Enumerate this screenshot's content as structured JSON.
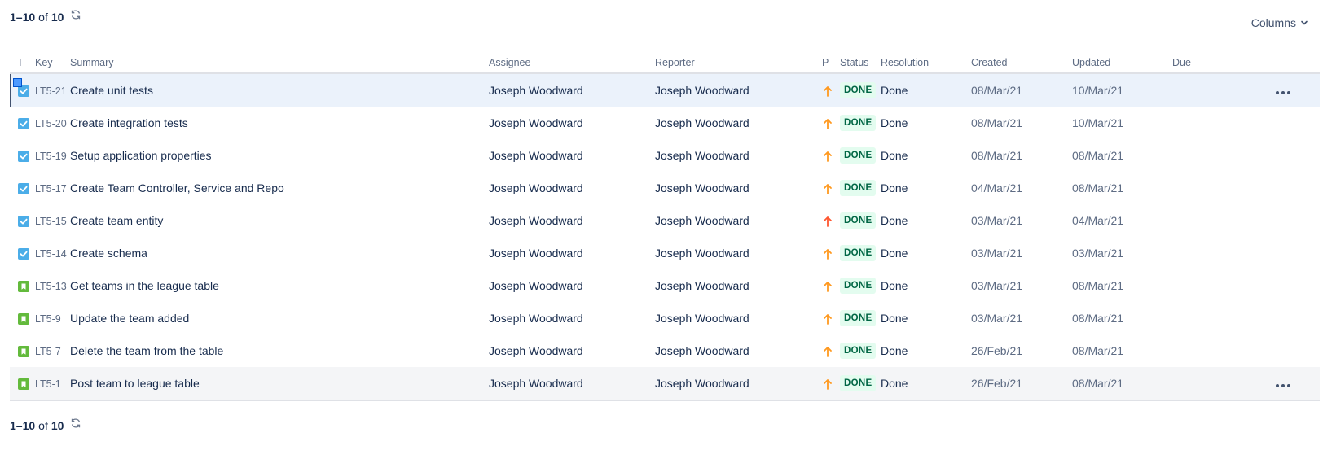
{
  "pager": {
    "range": "1–10",
    "of": "of",
    "total": "10"
  },
  "columns_button": "Columns",
  "headers": {
    "type": "T",
    "key": "Key",
    "summary": "Summary",
    "assignee": "Assignee",
    "reporter": "Reporter",
    "priority": "P",
    "status": "Status",
    "resolution": "Resolution",
    "created": "Created",
    "updated": "Updated",
    "due": "Due"
  },
  "colors": {
    "task": "#4bade8",
    "story": "#63ba3c",
    "priority_high": "#ff991f",
    "priority_highest": "#ff5630",
    "status_done_bg": "#e3fcef",
    "status_done_fg": "#006644"
  },
  "rows": [
    {
      "type": "task",
      "type_icon": "checkbox-icon",
      "key": "LT5-21",
      "summary": "Create unit tests",
      "assignee": "Joseph Woodward",
      "reporter": "Joseph Woodward",
      "priority": "high",
      "priority_icon": "arrow-up-icon",
      "status": "DONE",
      "resolution": "Done",
      "created": "08/Mar/21",
      "updated": "10/Mar/21",
      "due": ""
    },
    {
      "type": "task",
      "type_icon": "checkbox-icon",
      "key": "LT5-20",
      "summary": "Create integration tests",
      "assignee": "Joseph Woodward",
      "reporter": "Joseph Woodward",
      "priority": "high",
      "priority_icon": "arrow-up-icon",
      "status": "DONE",
      "resolution": "Done",
      "created": "08/Mar/21",
      "updated": "10/Mar/21",
      "due": ""
    },
    {
      "type": "task",
      "type_icon": "checkbox-icon",
      "key": "LT5-19",
      "summary": "Setup application properties",
      "assignee": "Joseph Woodward",
      "reporter": "Joseph Woodward",
      "priority": "high",
      "priority_icon": "arrow-up-icon",
      "status": "DONE",
      "resolution": "Done",
      "created": "08/Mar/21",
      "updated": "08/Mar/21",
      "due": ""
    },
    {
      "type": "task",
      "type_icon": "checkbox-icon",
      "key": "LT5-17",
      "summary": "Create Team Controller, Service and Repo",
      "assignee": "Joseph Woodward",
      "reporter": "Joseph Woodward",
      "priority": "high",
      "priority_icon": "arrow-up-icon",
      "status": "DONE",
      "resolution": "Done",
      "created": "04/Mar/21",
      "updated": "08/Mar/21",
      "due": ""
    },
    {
      "type": "task",
      "type_icon": "checkbox-icon",
      "key": "LT5-15",
      "summary": "Create team entity",
      "assignee": "Joseph Woodward",
      "reporter": "Joseph Woodward",
      "priority": "highest",
      "priority_icon": "arrow-up-icon",
      "status": "DONE",
      "resolution": "Done",
      "created": "03/Mar/21",
      "updated": "04/Mar/21",
      "due": ""
    },
    {
      "type": "task",
      "type_icon": "checkbox-icon",
      "key": "LT5-14",
      "summary": "Create schema",
      "assignee": "Joseph Woodward",
      "reporter": "Joseph Woodward",
      "priority": "high",
      "priority_icon": "arrow-up-icon",
      "status": "DONE",
      "resolution": "Done",
      "created": "03/Mar/21",
      "updated": "03/Mar/21",
      "due": ""
    },
    {
      "type": "story",
      "type_icon": "bookmark-icon",
      "key": "LT5-13",
      "summary": "Get teams in the league table",
      "assignee": "Joseph Woodward",
      "reporter": "Joseph Woodward",
      "priority": "high",
      "priority_icon": "arrow-up-icon",
      "status": "DONE",
      "resolution": "Done",
      "created": "03/Mar/21",
      "updated": "08/Mar/21",
      "due": ""
    },
    {
      "type": "story",
      "type_icon": "bookmark-icon",
      "key": "LT5-9",
      "summary": "Update the team added",
      "assignee": "Joseph Woodward",
      "reporter": "Joseph Woodward",
      "priority": "high",
      "priority_icon": "arrow-up-icon",
      "status": "DONE",
      "resolution": "Done",
      "created": "03/Mar/21",
      "updated": "08/Mar/21",
      "due": ""
    },
    {
      "type": "story",
      "type_icon": "bookmark-icon",
      "key": "LT5-7",
      "summary": "Delete the team from the table",
      "assignee": "Joseph Woodward",
      "reporter": "Joseph Woodward",
      "priority": "high",
      "priority_icon": "arrow-up-icon",
      "status": "DONE",
      "resolution": "Done",
      "created": "26/Feb/21",
      "updated": "08/Mar/21",
      "due": ""
    },
    {
      "type": "story",
      "type_icon": "bookmark-icon",
      "key": "LT5-1",
      "summary": "Post team to league table",
      "assignee": "Joseph Woodward",
      "reporter": "Joseph Woodward",
      "priority": "high",
      "priority_icon": "arrow-up-icon",
      "status": "DONE",
      "resolution": "Done",
      "created": "26/Feb/21",
      "updated": "08/Mar/21",
      "due": ""
    }
  ],
  "row_states": {
    "selected_row": 0,
    "hover_row": 9
  }
}
